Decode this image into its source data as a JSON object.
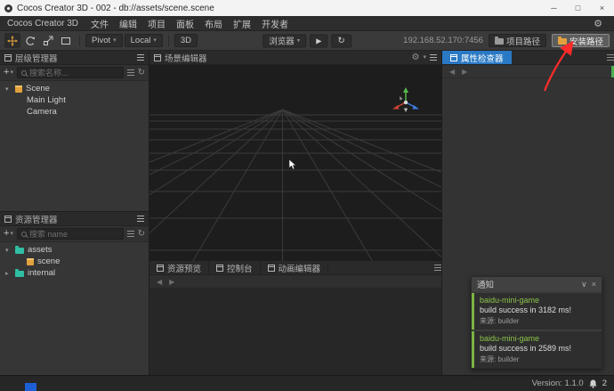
{
  "window": {
    "title": "Cocos Creator 3D - 002 - db://assets/scene.scene"
  },
  "glyphs": {
    "minimize": "─",
    "maximize": "□",
    "close": "×",
    "caret_down": "▾",
    "caret_right": "▸",
    "gear": "⚙",
    "play": "▶",
    "refresh": "↻",
    "nav_left": "◀",
    "nav_right": "▶",
    "plus": "+",
    "chevron_down": "∨",
    "close_small": "×"
  },
  "menu": {
    "app": "Cocos Creator 3D",
    "items": [
      "文件",
      "编辑",
      "项目",
      "面板",
      "布局",
      "扩展",
      "开发者"
    ]
  },
  "toolbar": {
    "pivot": "Pivot",
    "coord": "Local",
    "mode": "3D",
    "preview_target": "浏览器",
    "ip": "192.168.52.170:7456",
    "project_path": "项目路径",
    "install_path": "安装路径"
  },
  "hierarchy": {
    "title": "层级管理器",
    "search_placeholder": "搜索名称...",
    "items": [
      {
        "label": "Scene"
      },
      {
        "label": "Main Light"
      },
      {
        "label": "Camera"
      }
    ]
  },
  "assets": {
    "title": "资源管理器",
    "search_placeholder": "搜索 name",
    "items": [
      {
        "label": "assets"
      },
      {
        "label": "scene"
      },
      {
        "label": "internal"
      }
    ]
  },
  "scene_editor": {
    "title": "场景编辑器"
  },
  "preview_tabs": {
    "tabs": [
      {
        "label": "资源预览"
      },
      {
        "label": "控制台"
      },
      {
        "label": "动画编辑器"
      }
    ]
  },
  "inspector": {
    "title": "属性检查器"
  },
  "notifications": {
    "title": "通知",
    "entries": [
      {
        "name": "baidu-mini-game",
        "message": "build success in 3182 ms!",
        "source": "来源: builder"
      },
      {
        "name": "baidu-mini-game",
        "message": "build success in 2589 ms!",
        "source": "来源: builder"
      }
    ]
  },
  "statusbar": {
    "version": "Version: 1.1.0",
    "badge": "2"
  },
  "colors": {
    "inspector_tab_blue": "#2a79c4",
    "tool_orange": "#e2a13c",
    "notify_green": "#8bc34a",
    "annotation_red": "#ff2b2b",
    "taskbar_blue": "#1d5fd6"
  }
}
